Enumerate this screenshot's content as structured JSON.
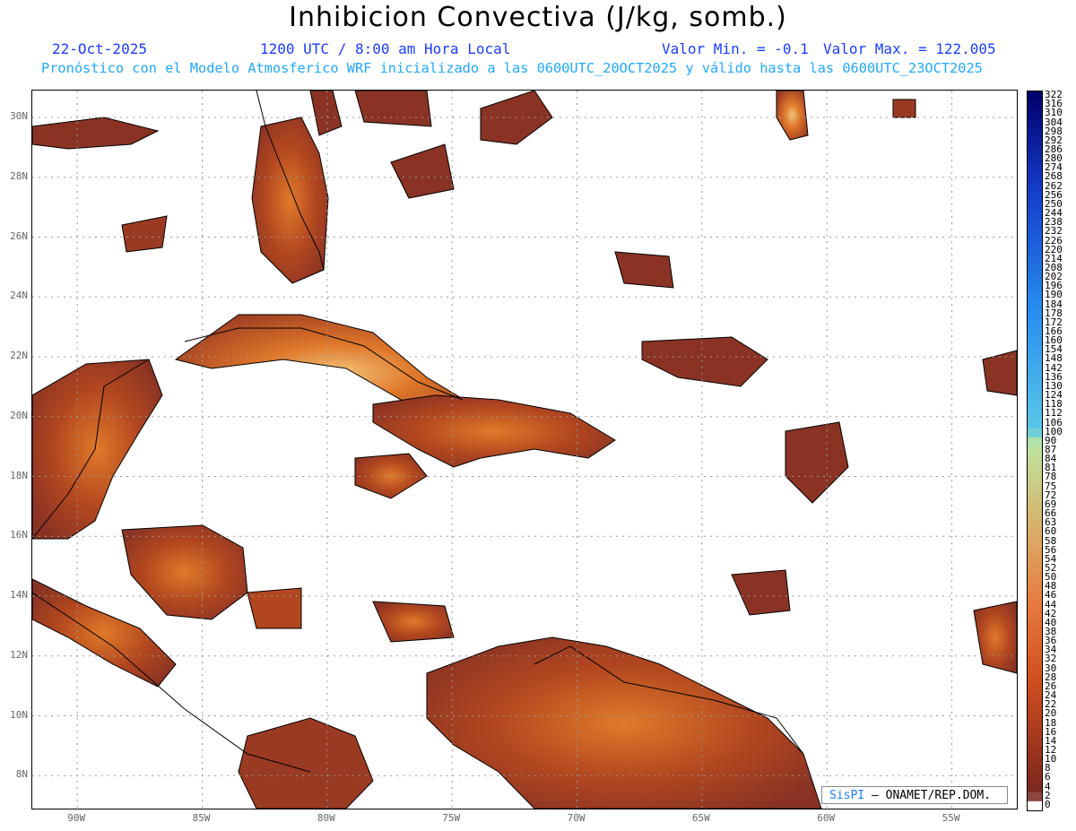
{
  "title": "Inhibicion Convectiva (J/kg, somb.)",
  "header": {
    "date": "22-Oct-2025",
    "time": "1200 UTC / 8:00 am Hora Local",
    "min": "Valor Min. = -0.1",
    "max": "Valor Max. = 122.005",
    "forecast": "Pronóstico con el Modelo Atmosferico WRF inicializado a las 0600UTC_20OCT2025 y válido hasta las  0600UTC_23OCT2025"
  },
  "map": {
    "lon_range": [
      -91.8,
      -52.4
    ],
    "lat_range": [
      6.9,
      30.9
    ],
    "lon_ticks": [
      {
        "value": -90,
        "label": "90W"
      },
      {
        "value": -85,
        "label": "85W"
      },
      {
        "value": -80,
        "label": "80W"
      },
      {
        "value": -75,
        "label": "75W"
      },
      {
        "value": -70,
        "label": "70W"
      },
      {
        "value": -65,
        "label": "65W"
      },
      {
        "value": -60,
        "label": "60W"
      },
      {
        "value": -55,
        "label": "55W"
      }
    ],
    "lat_ticks": [
      {
        "value": 30,
        "label": "30N"
      },
      {
        "value": 28,
        "label": "28N"
      },
      {
        "value": 26,
        "label": "26N"
      },
      {
        "value": 24,
        "label": "24N"
      },
      {
        "value": 22,
        "label": "22N"
      },
      {
        "value": 20,
        "label": "20N"
      },
      {
        "value": 18,
        "label": "18N"
      },
      {
        "value": 16,
        "label": "16N"
      },
      {
        "value": 14,
        "label": "14N"
      },
      {
        "value": 12,
        "label": "12N"
      },
      {
        "value": 10,
        "label": "10N"
      },
      {
        "value": 8,
        "label": "8N"
      }
    ],
    "grid": true,
    "field_colors": {
      "low": "#8a3324",
      "mid": "#c85a1e",
      "high": "#f0c070",
      "peak": "#7fe0c8"
    }
  },
  "colorbar": {
    "labels": [
      "322",
      "316",
      "310",
      "304",
      "298",
      "292",
      "286",
      "280",
      "274",
      "268",
      "262",
      "256",
      "250",
      "244",
      "238",
      "232",
      "226",
      "220",
      "214",
      "208",
      "202",
      "196",
      "190",
      "184",
      "178",
      "172",
      "166",
      "160",
      "154",
      "148",
      "142",
      "136",
      "130",
      "124",
      "118",
      "112",
      "106",
      "100",
      "90",
      "87",
      "84",
      "81",
      "78",
      "75",
      "72",
      "69",
      "66",
      "63",
      "60",
      "58",
      "56",
      "54",
      "52",
      "50",
      "48",
      "46",
      "44",
      "42",
      "40",
      "38",
      "36",
      "34",
      "32",
      "30",
      "28",
      "26",
      "24",
      "22",
      "20",
      "18",
      "16",
      "14",
      "12",
      "10",
      "8",
      "6",
      "4",
      "2",
      "0"
    ]
  },
  "credit": {
    "brand": "SisPI",
    "text": "– ONAMET/REP.DOM."
  }
}
